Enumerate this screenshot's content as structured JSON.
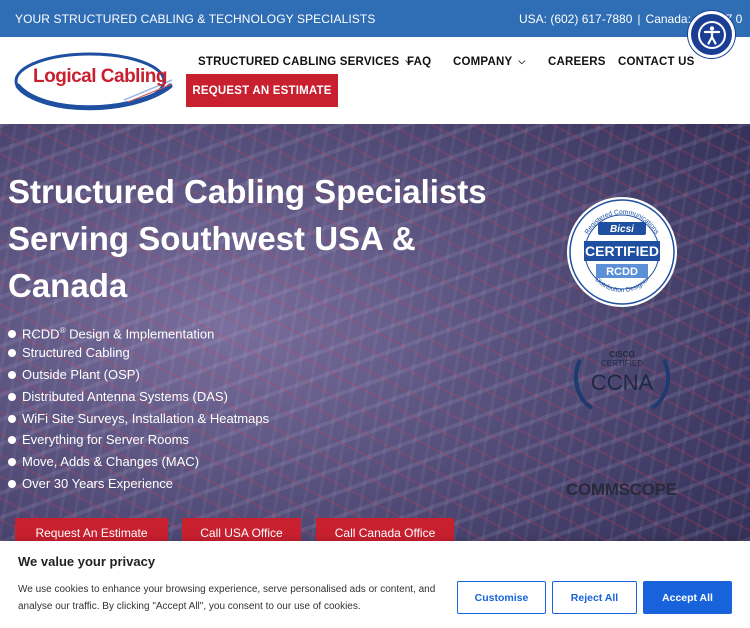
{
  "topbar": {
    "tagline": "YOUR STRUCTURED CABLING & TECHNOLOGY SPECIALISTS",
    "usa_phone": "USA: (602) 617-7880",
    "separator": "|",
    "canada_phone": "Canada: (289) 7   0"
  },
  "logo": {
    "text": "Logical Cabling"
  },
  "nav": {
    "items": [
      {
        "label": "STRUCTURED CABLING SERVICES",
        "has_dropdown": true
      },
      {
        "label": "FAQ",
        "has_dropdown": false
      },
      {
        "label": "COMPANY",
        "has_dropdown": true
      },
      {
        "label": "CAREERS",
        "has_dropdown": false
      },
      {
        "label": "CONTACT US",
        "has_dropdown": false
      }
    ],
    "estimate_button": "REQUEST AN ESTIMATE"
  },
  "hero": {
    "title": "Structured Cabling Specialists Serving Southwest USA & Canada",
    "bullets": {
      "rcdd_prefix": "RCDD",
      "rcdd_reg": "®",
      "rcdd_suffix": " Design & Implementation",
      "items": [
        "Structured Cabling",
        "Outside Plant (OSP)",
        "Distributed Antenna Systems (DAS)",
        "WiFi Site Surveys, Installation & Heatmaps",
        "Everything for Server Rooms",
        "Move, Adds & Changes (MAC)",
        "Over 30 Years Experience"
      ]
    },
    "certs": {
      "bicsi_ring_top": "Registered Communications",
      "bicsi_ring_bottom": "Distribution Designer",
      "bicsi_brand": "Bicsi",
      "bicsi_certified": "CERTIFIED",
      "bicsi_rcdd": "RCDD",
      "ccna_brand": "CISCO",
      "ccna_certified": "CERTIFIED",
      "ccna_name": "CCNA",
      "commscope": "COMMSCOPE"
    },
    "buttons": {
      "estimate": "Request An Estimate",
      "usa": "Call USA Office",
      "canada": "Call Canada Office"
    }
  },
  "cookie": {
    "title": "We value your privacy",
    "text": "We use cookies to enhance your browsing experience, serve personalised ads or content, and analyse our traffic. By clicking \"Accept All\", you consent to our use of cookies.",
    "customise": "Customise",
    "reject": "Reject All",
    "accept": "Accept All"
  },
  "colors": {
    "topbar_blue": "#2f6db5",
    "accent_red": "#c8202f",
    "cookie_blue": "#1863dc",
    "a11y_navy": "#1a3e93"
  }
}
